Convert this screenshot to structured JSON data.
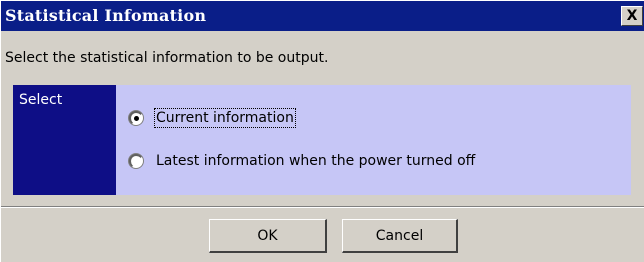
{
  "window": {
    "title": "Statistical Infomation",
    "close_label": "X"
  },
  "instruction": "Select the statistical information to be output.",
  "group": {
    "label": "Select",
    "options": [
      {
        "label": "Current information",
        "selected": true
      },
      {
        "label": "Latest information when the power turned off",
        "selected": false
      }
    ]
  },
  "buttons": {
    "ok": "OK",
    "cancel": "Cancel"
  },
  "colors": {
    "titlebar": "#0a1e88",
    "group_label_bg": "#0e0e86",
    "group_bg": "#c6c6f6",
    "dialog_bg": "#d4d0c8"
  }
}
